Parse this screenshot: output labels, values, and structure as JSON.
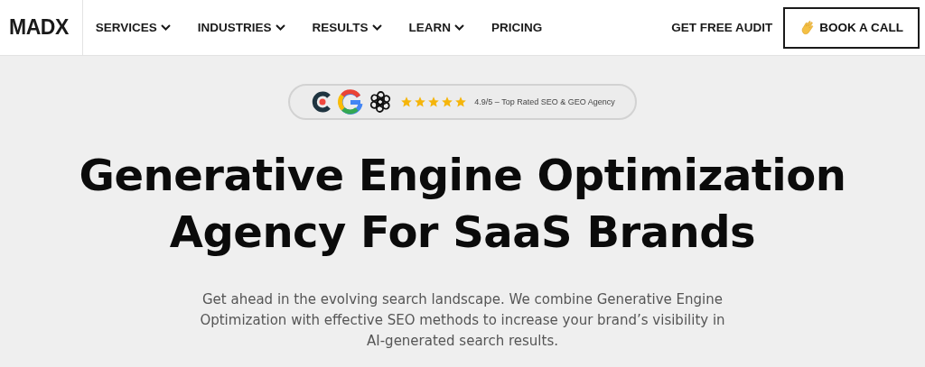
{
  "nav": {
    "logo": "MADX",
    "items": [
      {
        "label": "SERVICES",
        "dropdown": true
      },
      {
        "label": "INDUSTRIES",
        "dropdown": true
      },
      {
        "label": "RESULTS",
        "dropdown": true
      },
      {
        "label": "LEARN",
        "dropdown": true
      },
      {
        "label": "PRICING",
        "dropdown": false
      }
    ],
    "audit_link": "GET FREE AUDIT",
    "cta": "BOOK A CALL"
  },
  "rating_badge": {
    "stars": 5,
    "text": "4.9/5 – Top Rated SEO & GEO Agency"
  },
  "hero": {
    "title_lines": [
      "Generative Engine Optimization",
      "Agency For SaaS Brands"
    ],
    "description": "Get ahead in the evolving search landscape. We combine Generative Engine Optimization with effective SEO methods to increase your brand’s visibility in AI-generated search results."
  }
}
